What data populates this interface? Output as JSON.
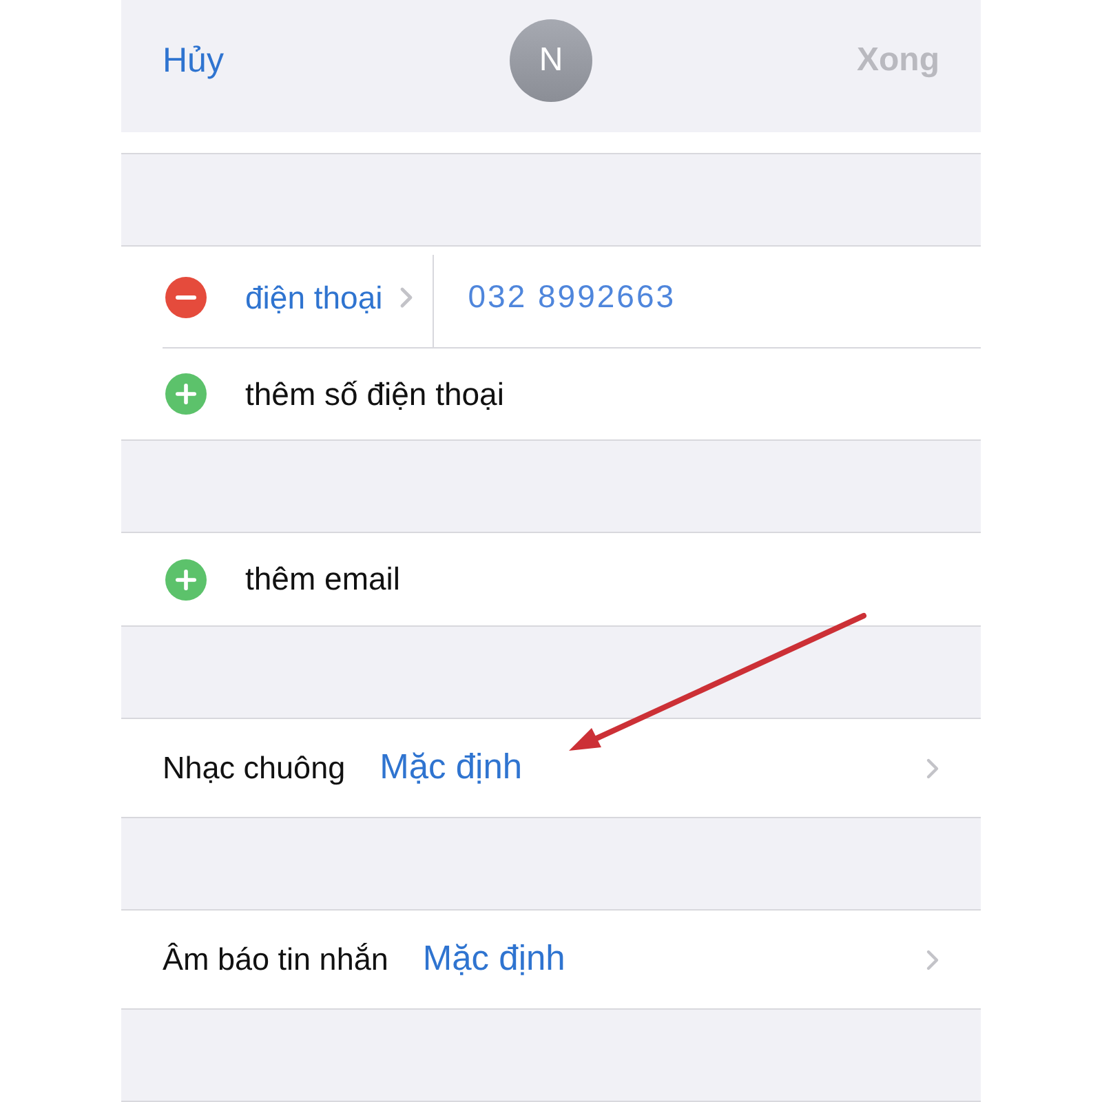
{
  "nav": {
    "cancel": "Hủy",
    "avatar_initial": "N",
    "done": {
      "label": "Xong",
      "disabled": true
    }
  },
  "sections": [
    {
      "rows": [
        {
          "kind": "field",
          "label": "điện thoại",
          "value": "032 8992663"
        },
        {
          "kind": "add",
          "label": "thêm số điện thoại"
        }
      ]
    },
    {
      "rows": [
        {
          "kind": "add",
          "label": "thêm email"
        }
      ]
    },
    {
      "rows": [
        {
          "kind": "setting",
          "label": "Nhạc chuông",
          "value": "Mặc định"
        }
      ]
    },
    {
      "rows": [
        {
          "kind": "setting",
          "label": "Âm báo tin nhắn",
          "value": "Mặc định"
        }
      ]
    }
  ]
}
